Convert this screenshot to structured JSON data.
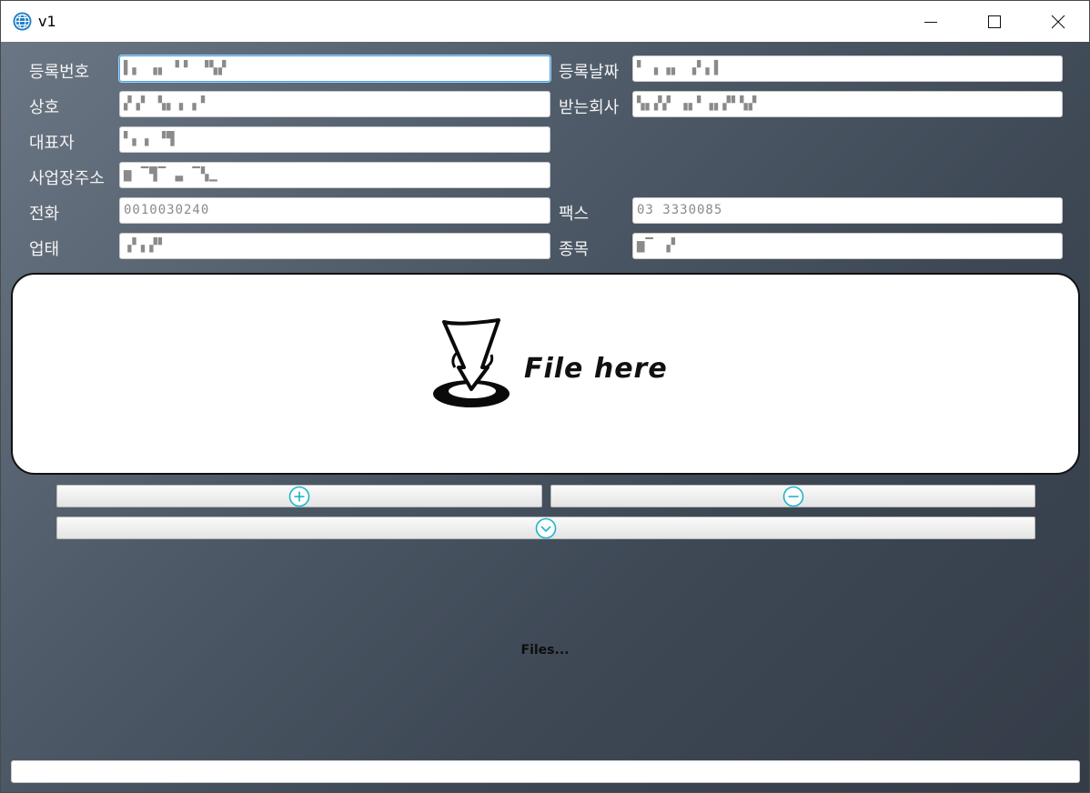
{
  "window": {
    "title": "v1"
  },
  "form": {
    "reg_no": {
      "label": "등록번호",
      "value": "▌▖ ▗▖ ▘▘ ▝▚▞"
    },
    "reg_date": {
      "label": "등록날짜",
      "value": "▘ ▖▗▖ ▗▘▖▌"
    },
    "company": {
      "label": "상호",
      "value": "▞▗▘ ▚▖▗ ▖▘"
    },
    "recv_company": {
      "label": "받는회사",
      "value": "▚▖▞▞ ▗▖▘▗▖▞▘▚▞"
    },
    "ceo": {
      "label": "대표자",
      "value": "▘▖▗ ▝▜"
    },
    "address": {
      "label": "사업장주소",
      "value": "▆ ▔▜▔  ▃ ▔▚▁"
    },
    "phone": {
      "label": "전화",
      "value": "0010030240"
    },
    "fax": {
      "label": "팩스",
      "value": "03 3330085"
    },
    "biz_type": {
      "label": "업태",
      "value": "▗▘▖▞▘"
    },
    "biz_item": {
      "label": "종목",
      "value": "▆▔ ▗▘"
    }
  },
  "dropzone": {
    "text": "File here",
    "icon": "drop-arrow-icon"
  },
  "buttons": {
    "add_icon": "plus-circle-icon",
    "remove_icon": "minus-circle-icon",
    "expand_icon": "chevron-down-circle-icon"
  },
  "files": {
    "label": "Files..."
  },
  "colors": {
    "accent": "#1fb3c9",
    "background_start": "#6b7684",
    "background_end": "#333c47"
  }
}
